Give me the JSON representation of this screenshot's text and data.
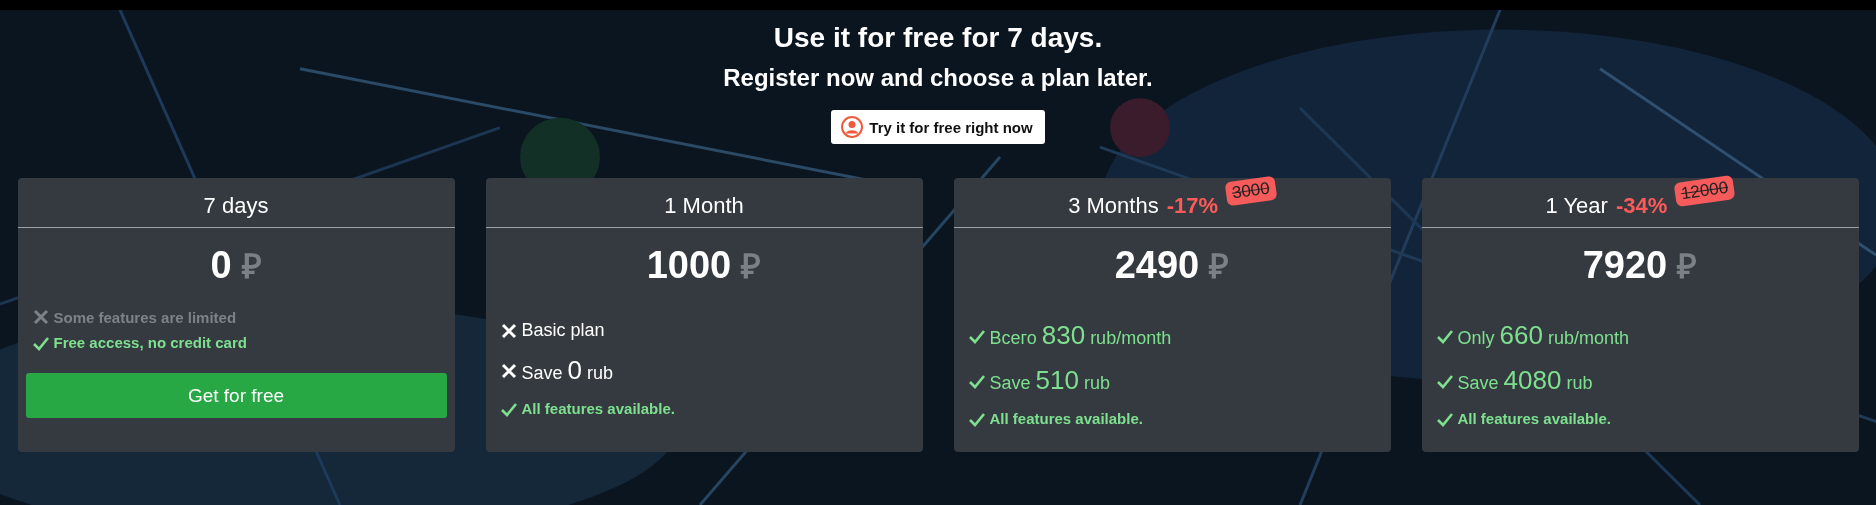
{
  "hero": {
    "title": "Use it for free for 7 days.",
    "subtitle": "Register now and choose a plan later.",
    "button": "Try it for free right now"
  },
  "plans": [
    {
      "name": "7 days",
      "price": "0",
      "currency": "₽",
      "features": [
        {
          "kind": "cross",
          "muted": true,
          "bold": true,
          "label": "Some features are limited"
        },
        {
          "kind": "check",
          "muted": false,
          "bold": true,
          "label": "Free access, no credit card"
        }
      ],
      "button": "Get for free"
    },
    {
      "name": "1 Month",
      "price": "1000",
      "currency": "₽",
      "features": [
        {
          "kind": "cross",
          "muted": false,
          "bold": false,
          "label": "Basic plan"
        },
        {
          "kind": "cross",
          "muted": false,
          "bold": false,
          "label": "Save",
          "amount": "0",
          "unit": "rub"
        },
        {
          "kind": "check",
          "muted": false,
          "bold": true,
          "label": "All features available."
        }
      ]
    },
    {
      "name": "3 Months",
      "discount": "-17%",
      "old_price": "3000",
      "price": "2490",
      "currency": "₽",
      "features": [
        {
          "kind": "check",
          "muted": false,
          "bold": false,
          "label": "Всего",
          "amount": "830",
          "unit": "rub/month"
        },
        {
          "kind": "check",
          "muted": false,
          "bold": false,
          "label": "Save",
          "amount": "510",
          "unit": "rub"
        },
        {
          "kind": "check",
          "muted": false,
          "bold": true,
          "label": "All features available."
        }
      ]
    },
    {
      "name": "1 Year",
      "discount": "-34%",
      "old_price": "12000",
      "price": "7920",
      "currency": "₽",
      "features": [
        {
          "kind": "check",
          "muted": false,
          "bold": false,
          "label": "Only",
          "amount": "660",
          "unit": "rub/month"
        },
        {
          "kind": "check",
          "muted": false,
          "bold": false,
          "label": "Save",
          "amount": "4080",
          "unit": "rub"
        },
        {
          "kind": "check",
          "muted": false,
          "bold": true,
          "label": "All features available."
        }
      ]
    }
  ]
}
